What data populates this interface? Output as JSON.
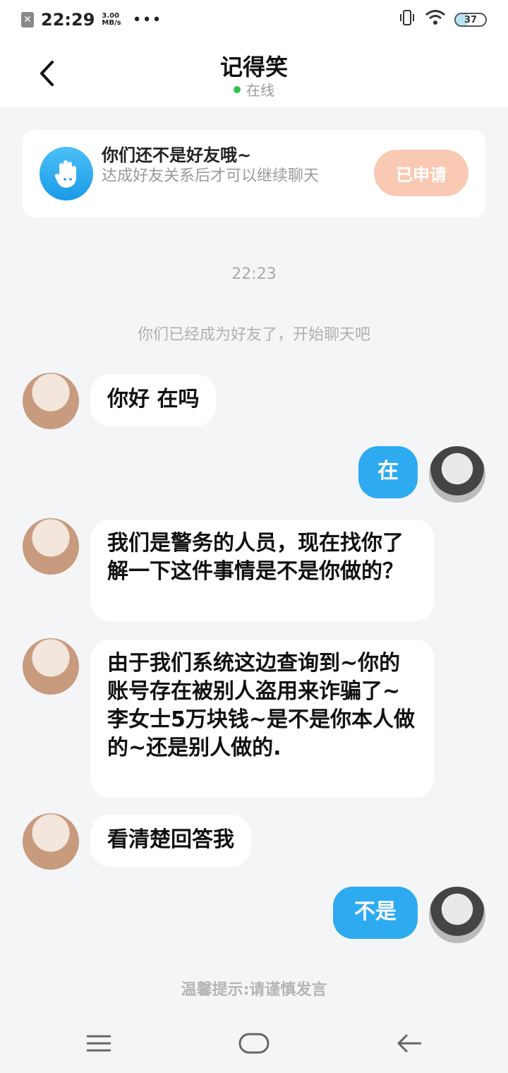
{
  "status_bar": {
    "time": "22:29",
    "speed_value": "3.00",
    "speed_unit": "MB/s",
    "dots": "•••",
    "battery": "37",
    "battery_level": 0.37
  },
  "header": {
    "title": "记得笑",
    "status": "在线"
  },
  "notice": {
    "title": "你们还不是好友哦~",
    "description": "达成好友关系后才可以继续聊天",
    "button": "已申请"
  },
  "chat": {
    "timestamp": "22:23",
    "system_message": "你们已经成为好友了，开始聊天吧",
    "messages": [
      {
        "side": "left",
        "text": "你好 在吗"
      },
      {
        "side": "right",
        "text": "在"
      },
      {
        "side": "left",
        "text": "我们是警务的人员，现在找你了解一下这件事情是不是你做的？"
      },
      {
        "side": "left",
        "text": "由于我们系统这边查询到~你的账号存在被别人盗用来诈骗了~李女士5万块钱~是不是你本人做的~还是别人做的."
      },
      {
        "side": "left",
        "text": "看清楚回答我"
      },
      {
        "side": "right",
        "text": "不是"
      }
    ]
  },
  "tip": "温馨提示:请谨慎发言",
  "colors": {
    "accent": "#2eaaf0",
    "online": "#33c24d",
    "apply_button": "#f9c9b3"
  }
}
